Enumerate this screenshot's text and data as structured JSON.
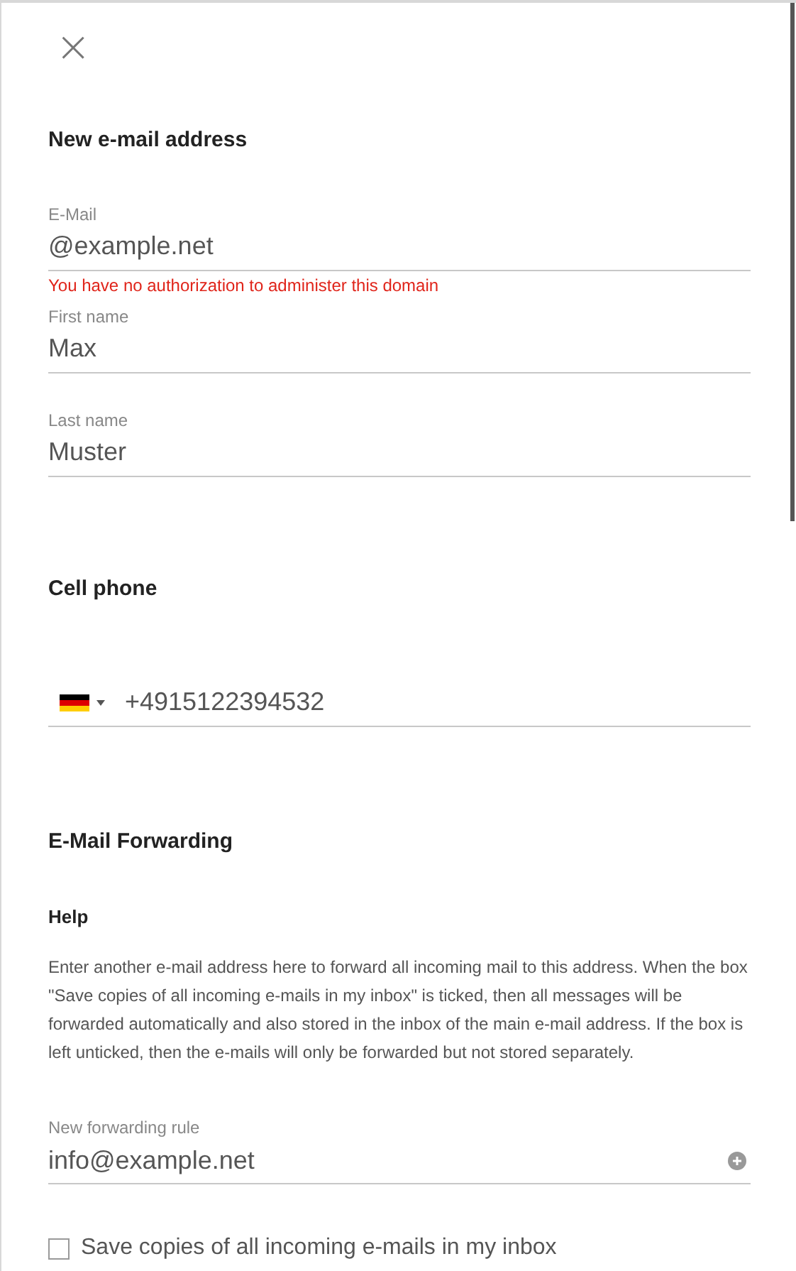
{
  "close_button": {
    "label": "×"
  },
  "sections": [
    {
      "kind": "contact",
      "title": "New e-mail address",
      "fields": [
        {
          "label": "E-Mail",
          "value": "@example.net",
          "error": "You have no authorization to administer this domain"
        },
        {
          "label": "First name",
          "value": "Max"
        },
        {
          "label": "Last name",
          "value": "Muster"
        }
      ]
    },
    {
      "kind": "phone",
      "title": "Cell phone",
      "value": "+4915122394532"
    },
    {
      "kind": "forwarding",
      "title": "E-Mail Forwarding",
      "help_title": "Help",
      "help_text": "Enter another e-mail address here to forward all incoming mail to this address. When the box \"Save copies of all incoming e-mails in my inbox\" is ticked, then all messages will be forwarded automatically and also stored in the inbox of the main e-mail address. If the box is left unticked, then the e-mails will only be forwarded but not stored separately.",
      "rule_label": "New forwarding rule",
      "rule_value": "info@example.net",
      "checkbox": {
        "label": "Save copies of all incoming e-mails in my inbox",
        "checked": false
      }
    }
  ]
}
